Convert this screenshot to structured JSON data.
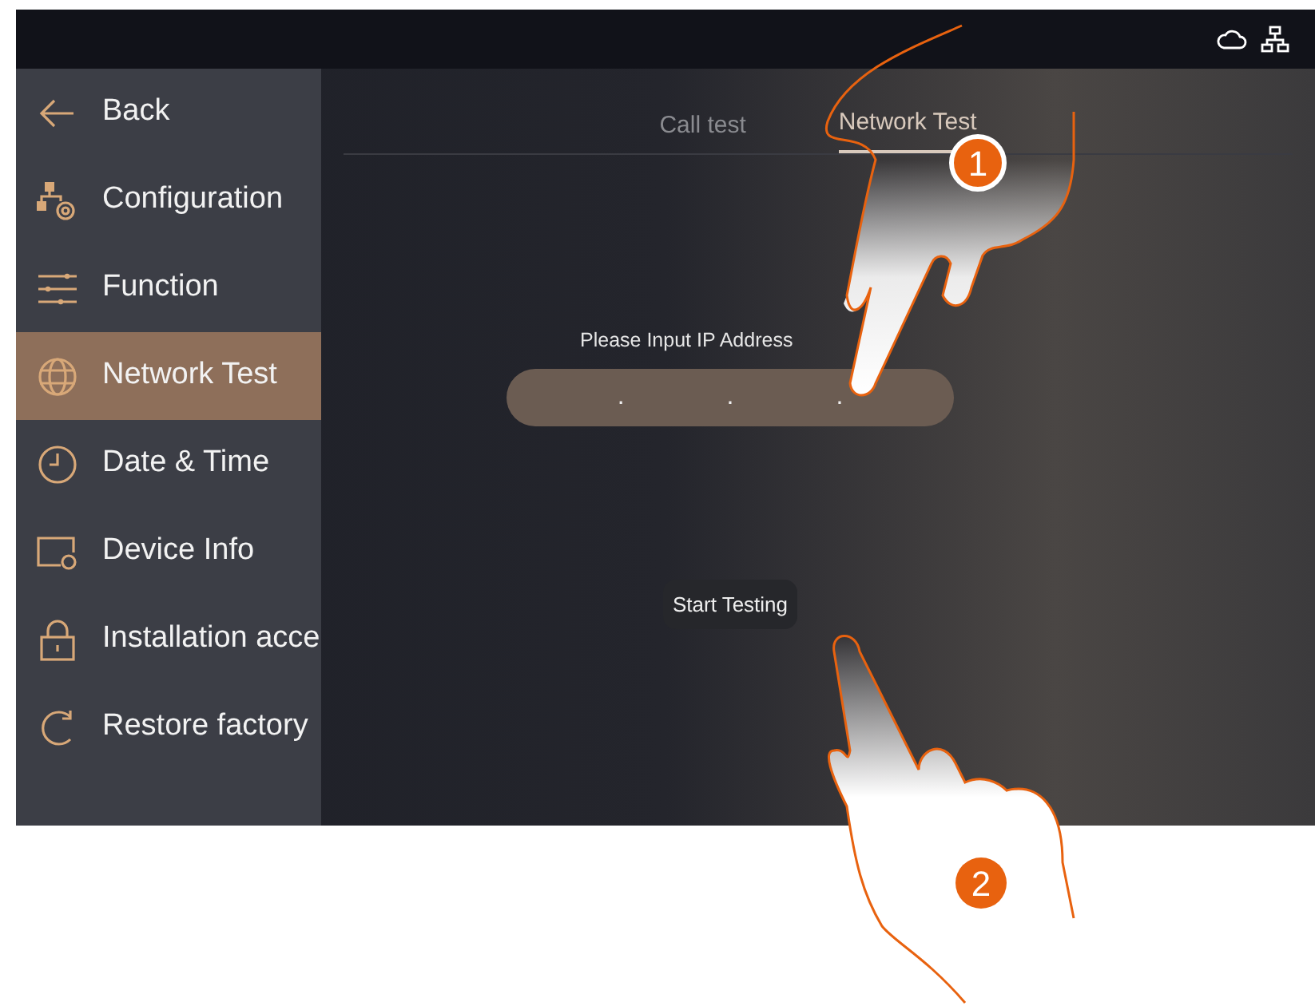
{
  "sidebar": {
    "items": [
      {
        "label": "Back",
        "selected": false
      },
      {
        "label": "Configuration",
        "selected": false
      },
      {
        "label": "Function",
        "selected": false
      },
      {
        "label": "Network Test",
        "selected": true
      },
      {
        "label": "Date & Time",
        "selected": false
      },
      {
        "label": "Device Info",
        "selected": false
      },
      {
        "label": "Installation acce",
        "selected": false
      },
      {
        "label": "Restore factory",
        "selected": false
      }
    ]
  },
  "tabs": [
    {
      "label": "Call test",
      "selected": false
    },
    {
      "label": "Network Test",
      "selected": true
    }
  ],
  "ip_field": {
    "label": "Please Input IP Address",
    "separators": [
      ".",
      ".",
      "."
    ]
  },
  "start_button": "Start Testing",
  "steps": [
    "1",
    "2"
  ]
}
